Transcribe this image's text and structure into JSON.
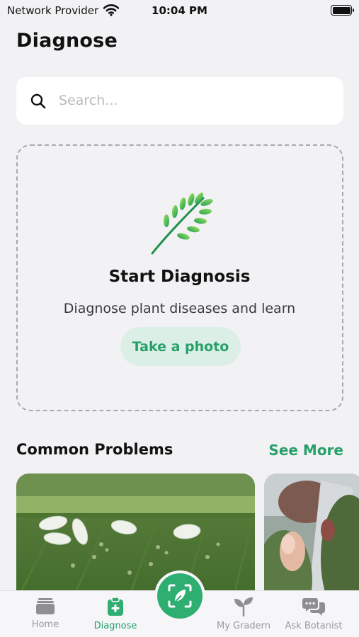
{
  "status_bar": {
    "carrier": "Network Provider",
    "time": "10:04 PM"
  },
  "page": {
    "title": "Diagnose"
  },
  "search": {
    "placeholder": "Search..."
  },
  "diagnosis_card": {
    "title": "Start Diagnosis",
    "subtitle": "Diagnose plant diseases and learn",
    "button_label": "Take a photo"
  },
  "common_problems": {
    "title": "Common Problems",
    "see_more_label": "See More"
  },
  "tab_bar": {
    "tabs": [
      {
        "label": "Home",
        "icon": "home-icon"
      },
      {
        "label": "Diagnose",
        "icon": "diagnose-icon",
        "active": true
      },
      {
        "label": "My Gradern",
        "icon": "sprout-icon"
      },
      {
        "label": "Ask Botanist",
        "icon": "chat-icon"
      }
    ],
    "center_button_icon": "scan-leaf-icon"
  },
  "colors": {
    "accent": "#27a06a",
    "accent_light": "#dcefe6",
    "background": "#f2f2f4"
  }
}
